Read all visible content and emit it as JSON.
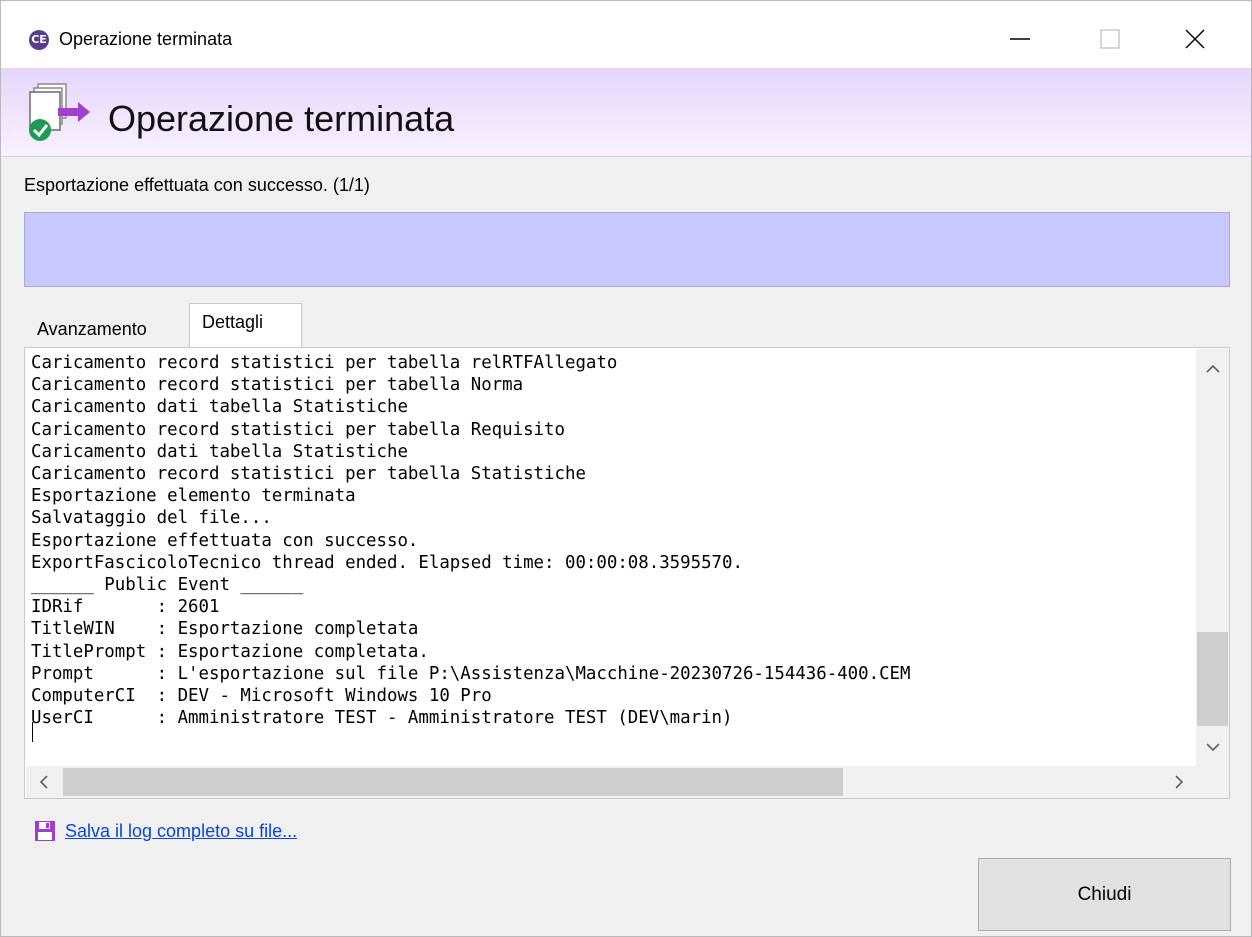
{
  "window": {
    "app_icon_text": "CE",
    "title": "Operazione terminata",
    "controls": {
      "minimize": "minimize-icon",
      "maximize": "maximize-icon",
      "close": "close-icon"
    }
  },
  "header": {
    "title": "Operazione terminata",
    "icon": "export-success-icon"
  },
  "status_text": "Esportazione effettuata con successo. (1/1)",
  "progress": {
    "value": 1.0,
    "color": "#c8c8ff"
  },
  "tabs": [
    {
      "label": "Avanzamento",
      "active": false
    },
    {
      "label": "Dettagli",
      "active": true
    }
  ],
  "log": {
    "lines": [
      "Caricamento record statistici per tabella relRTFAllegato",
      "Caricamento record statistici per tabella Norma",
      "Caricamento dati tabella Statistiche",
      "Caricamento record statistici per tabella Requisito",
      "Caricamento dati tabella Statistiche",
      "Caricamento record statistici per tabella Statistiche",
      "Esportazione elemento terminata",
      "Salvataggio del file...",
      "Esportazione effettuata con successo.",
      "ExportFascicoloTecnico thread ended. Elapsed time: 00:00:08.3595570.",
      "______ Public Event ______",
      "IDRif       : 2601",
      "TitleWIN    : Esportazione completata",
      "TitlePrompt : Esportazione completata.",
      "Prompt      : L'esportazione sul file P:\\Assistenza\\Macchine-20230726-154436-400.CEM",
      "ComputerCI  : DEV - Microsoft Windows 10 Pro",
      "UserCI      : Amministratore TEST - Amministratore TEST (DEV\\marin)"
    ]
  },
  "save_link": {
    "label": "Salva il log completo su file...",
    "icon": "floppy-disk-icon",
    "color": "#0645d6"
  },
  "close_button": {
    "label": "Chiudi"
  }
}
